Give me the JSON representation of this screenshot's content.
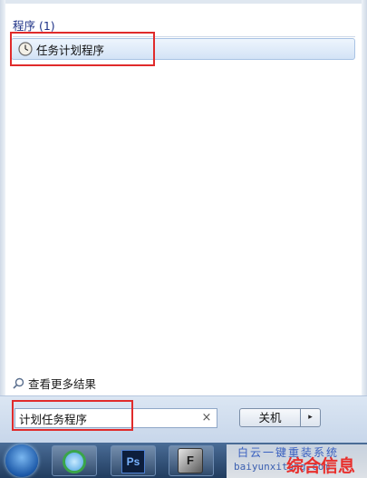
{
  "start_menu": {
    "group_header": "程序 (1)",
    "results": [
      {
        "label": "任务计划程序",
        "icon": "clock-icon"
      }
    ],
    "see_more": {
      "label": "查看更多结果",
      "icon": "magnifier-icon"
    },
    "search": {
      "value": "计划任务程序",
      "clear_symbol": "×"
    },
    "shutdown": {
      "label": "关机",
      "arrow": "▸"
    }
  },
  "taskbar": {
    "apps": [
      {
        "name": "Internet Explorer",
        "icon": "ie-icon"
      },
      {
        "name": "Photoshop",
        "icon": "ps-icon",
        "glyph": "Ps"
      },
      {
        "name": "FileZilla",
        "icon": "filezilla-icon",
        "glyph": "F"
      }
    ]
  },
  "watermark": {
    "line1": "白云一键重装系统",
    "line2": "baiyunxitong.com",
    "brand": "综合信息"
  },
  "colors": {
    "highlight": "#e02b2b",
    "header_text": "#1e3287",
    "taskbar": "#2b4a72"
  }
}
